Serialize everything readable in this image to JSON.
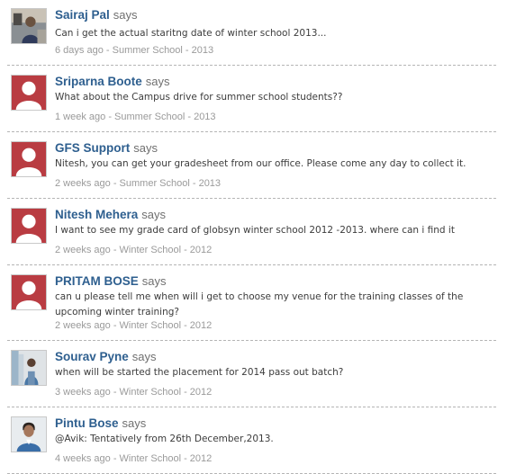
{
  "says_label": "says",
  "meta_separator": " - ",
  "comments": [
    {
      "author": "Sairaj Pal",
      "avatar": "photo",
      "text": "Can i get the actual staritng date of winter school 2013...",
      "time": "6 days ago",
      "category": "Summer School - 2013"
    },
    {
      "author": "Sriparna Boote",
      "avatar": "default",
      "text": "What about the Campus drive for summer school students??",
      "time": "1 week ago",
      "category": "Summer School - 2013"
    },
    {
      "author": "GFS Support",
      "avatar": "default",
      "text": "Nitesh, you can get your gradesheet from our office. Please come any day to collect it.",
      "time": "2 weeks ago",
      "category": "Summer School - 2013"
    },
    {
      "author": "Nitesh Mehera",
      "avatar": "default",
      "text": "I want to see my grade card of globsyn winter school 2012 -2013. where can i find it",
      "time": "2 weeks ago",
      "category": "Winter School - 2012"
    },
    {
      "author": "PRITAM BOSE",
      "avatar": "default",
      "text": "can u please tell me when will i get to choose my venue for the training classes of the upcoming winter training?",
      "time": "2 weeks ago",
      "category": "Winter School - 2012"
    },
    {
      "author": "Sourav Pyne",
      "avatar": "photo",
      "text": "when will be started the placement for 2014 pass out batch?",
      "time": "3 weeks ago",
      "category": "Winter School - 2012"
    },
    {
      "author": "Pintu Bose",
      "avatar": "photo",
      "text": "@Avik: Tentatively from 26th December,2013.",
      "time": "4 weeks ago",
      "category": "Winter School - 2012"
    }
  ],
  "colors": {
    "author": "#2e5f8f",
    "says": "#6f6f6f",
    "meta": "#9a9a9a",
    "default_avatar_bg": "#b93c42",
    "divider": "#b5b5b5"
  }
}
